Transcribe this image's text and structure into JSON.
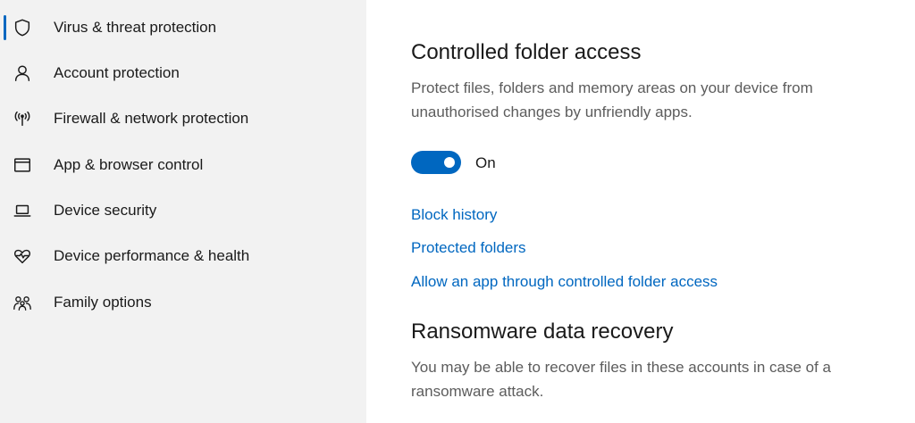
{
  "sidebar": {
    "items": [
      {
        "label": "Virus & threat protection",
        "icon": "shield-icon",
        "selected": true
      },
      {
        "label": "Account protection",
        "icon": "person-icon"
      },
      {
        "label": "Firewall & network protection",
        "icon": "antenna-icon"
      },
      {
        "label": "App & browser control",
        "icon": "browser-window-icon"
      },
      {
        "label": "Device security",
        "icon": "laptop-icon"
      },
      {
        "label": "Device performance & health",
        "icon": "heart-pulse-icon"
      },
      {
        "label": "Family options",
        "icon": "family-icon"
      }
    ]
  },
  "main": {
    "controlled_folder_access": {
      "title": "Controlled folder access",
      "description": "Protect files, folders and memory areas on your device from unauthorised changes by unfriendly apps.",
      "toggle_state": "On",
      "links": [
        "Block history",
        "Protected folders",
        "Allow an app through controlled folder access"
      ]
    },
    "ransomware_recovery": {
      "title": "Ransomware data recovery",
      "description": "You may be able to recover files in these accounts in case of a ransomware attack."
    }
  },
  "colors": {
    "accent": "#0067c0",
    "sidebar_bg": "#f2f2f2",
    "secondary_text": "#5c5c5c"
  }
}
